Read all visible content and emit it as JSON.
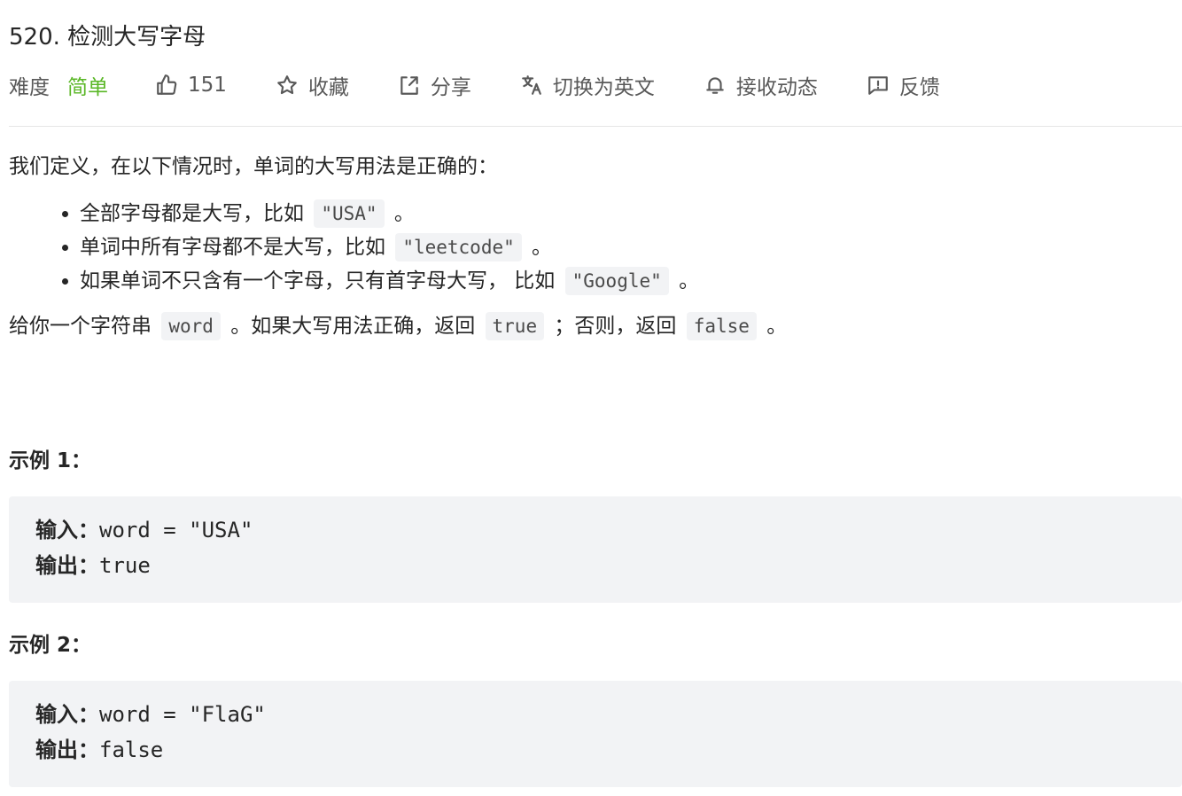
{
  "problem": {
    "title": "520. 检测大写字母",
    "difficulty_label": "难度",
    "difficulty_value": "简单",
    "likes": "151",
    "favorite_label": "收藏",
    "share_label": "分享",
    "switch_lang_label": "切换为英文",
    "subscribe_label": "接收动态",
    "feedback_label": "反馈"
  },
  "description": {
    "intro": "我们定义，在以下情况时，单词的大写用法是正确的：",
    "rules": [
      {
        "text": "全部字母都是大写，比如 ",
        "code": "\"USA\"",
        "tail": " 。"
      },
      {
        "text": "单词中所有字母都不是大写，比如 ",
        "code": "\"leetcode\"",
        "tail": " 。"
      },
      {
        "text": "如果单词不只含有一个字母，只有首字母大写， 比如 ",
        "code": "\"Google\"",
        "tail": " 。"
      }
    ],
    "task_part1": "给你一个字符串 ",
    "task_code1": "word",
    "task_part2": " 。如果大写用法正确，返回 ",
    "task_code2": "true",
    "task_part3": " ；否则，返回 ",
    "task_code3": "false",
    "task_part4": " 。"
  },
  "examples": [
    {
      "title": "示例 1：",
      "input_key": "输入：",
      "input_val": "word = \"USA\"",
      "output_key": "输出：",
      "output_val": "true"
    },
    {
      "title": "示例 2：",
      "input_key": "输入：",
      "input_val": "word = \"FlaG\"",
      "output_key": "输出：",
      "output_val": "false"
    }
  ],
  "icons": {
    "like": "thumbs-up-icon",
    "favorite": "star-icon",
    "share": "share-icon",
    "translate": "translate-icon",
    "subscribe": "bell-icon",
    "feedback": "feedback-icon"
  },
  "colors": {
    "difficulty_easy": "#5ab726",
    "code_bg": "#f2f3f5",
    "text": "#262626",
    "muted": "#595959"
  }
}
